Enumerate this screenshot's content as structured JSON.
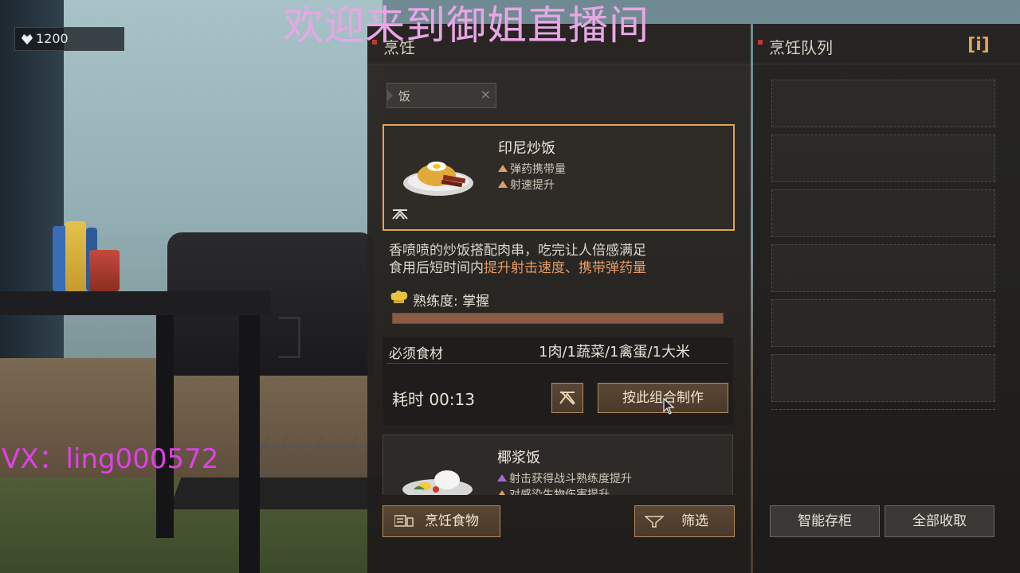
{
  "overlay": {
    "stream_banner": "欢迎来到御姐直播间",
    "vx_banner": "VX：ling000572"
  },
  "hud": {
    "currency_icon": "diamond-heart-icon",
    "currency_value": "1200"
  },
  "cook_panel": {
    "title": "烹饪",
    "search_value": "饭",
    "selected_recipe": {
      "name": "印尼炒饭",
      "buffs": [
        "弹药携带量",
        "射速提升"
      ],
      "description_line1": "香喷喷的炒饭搭配肉串，吃完让人倍感满足",
      "description_line2_prefix": "食用后短时间内",
      "description_line2_highlight": "提升射击速度、携带弹药量"
    },
    "proficiency_label": "熟练度: 掌握",
    "proficiency_fraction": 1.0,
    "ingredients_label": "必须食材",
    "ingredients_value": "1肉/1蔬菜/1禽蛋/1大米",
    "time_label": "耗时 00:13",
    "craft_button": "按此组合制作",
    "second_recipe": {
      "name": "椰浆饭",
      "buffs": [
        "射击获得战斗熟练度提升",
        "对感染生物伤害提升"
      ]
    },
    "food_button": "烹饪食物",
    "filter_button": "筛选"
  },
  "queue_panel": {
    "title": "烹饪队列",
    "info_label": "[i]",
    "slot_count": 7,
    "smart_storage_button": "智能存柜",
    "collect_all_button": "全部收取"
  },
  "colors": {
    "accent": "#e0a45c",
    "highlight_text": "#e59b63",
    "banner_pink": "#e8a6e6",
    "vx_magenta": "#e040e8"
  }
}
